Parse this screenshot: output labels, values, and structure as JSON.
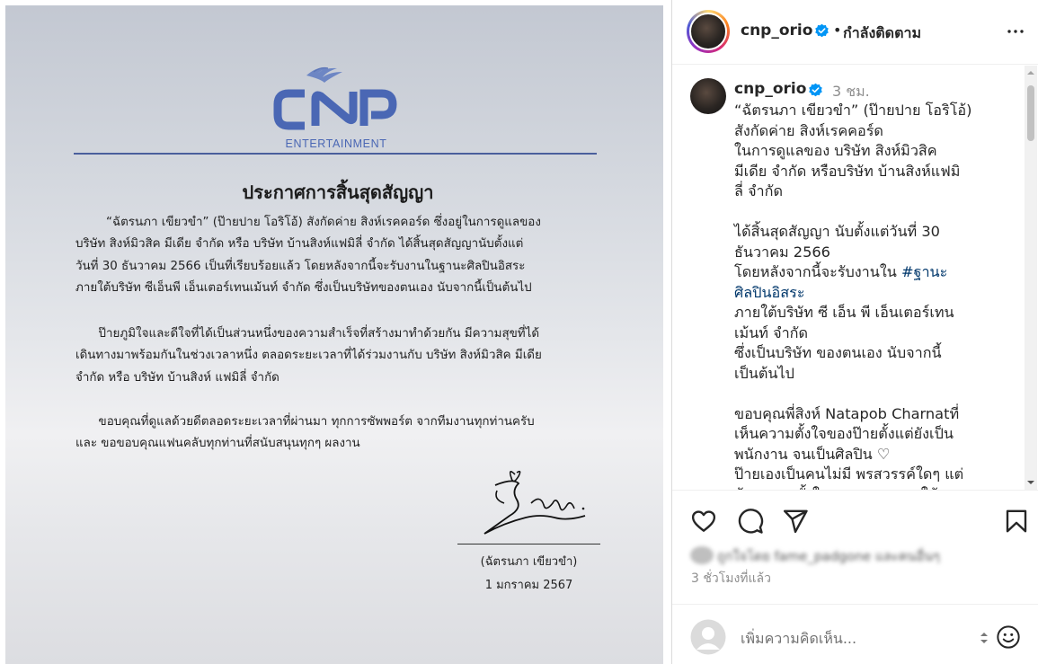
{
  "announcement": {
    "logo_text": "ENTERTAINMENT",
    "title": "ประกาศการสิ้นสุดสัญญา",
    "paragraphs": [
      [
        "        “ฉัตรนภา เขียวขำ” (ป๊ายปาย โอริโอ้) สังกัดค่าย สิงห์เรคคอร์ด ซึ่งอยู่ในการดูแลของ",
        "บริษัท สิงห์มิวสิค มีเดีย จำกัด หรือ บริษัท บ้านสิงห์แฟมิลี่ จำกัด ได้สิ้นสุดสัญญานับตั้งแต่",
        "วันที่ 30 ธันวาคม 2566 เป็นที่เรียบร้อยแล้ว โดยหลังจากนี้จะรับงานในฐานะศิลปินอิสระ",
        "ภายใต้บริษัท ซีเอ็นพี เอ็นเตอร์เทนเม้นท์ จำกัด ซึ่งเป็นบริษัทของตนเอง นับจากนี้เป็นต้นไป"
      ],
      [
        "      ป๊ายภูมิใจและดีใจที่ได้เป็นส่วนหนึ่งของความสำเร็จที่สร้างมาทำด้วยกัน มีความสุขที่ได้",
        "เดินทางมาพร้อมกันในช่วงเวลาหนึ่ง ตลอดระยะเวลาที่ได้ร่วมงานกับ บริษัท สิงห์มิวสิค มีเดีย",
        "จำกัด หรือ บริษัท บ้านสิงห์ แฟมิลี่ จำกัด"
      ],
      [
        "      ขอบคุณที่ดูแลด้วยดีตลอดระยะเวลาที่ผ่านมา ทุกการซัพพอร์ต จากทีมงานทุกท่านครับ",
        "และ ขอขอบคุณแฟนคลับทุกท่านที่สนับสนุนทุกๆ ผลงาน"
      ]
    ],
    "signature_name": "(ฉัตรนภา เขียวขำ)",
    "signature_date": "1 มกราคม 2567"
  },
  "header": {
    "username": "cnp_orio",
    "separator": "•",
    "follow_status": "กำลังติดตาม",
    "more_icon": "more-horizontal-icon"
  },
  "caption": {
    "username": "cnp_orio",
    "time": "3 ชม.",
    "lines": [
      {
        "text": "“ฉัตรนภา เขียวขำ” (ป๊ายปาย โอริโอ้)"
      },
      {
        "text": "สังกัดค่าย สิงห์เรคคอร์ด"
      },
      {
        "text": "ในการดูแลของ บริษัท สิงห์มิวสิค"
      },
      {
        "text": "มีเดีย จำกัด หรือบริษัท บ้านสิงห์แฟมิ"
      },
      {
        "text": "ลี่ จำกัด"
      },
      {
        "text": ""
      },
      {
        "text": "ได้สิ้นสุดสัญญา นับตั้งแต่วันที่ 30"
      },
      {
        "text": "ธันวาคม 2566"
      },
      {
        "text": "โดยหลังจากนี้จะรับงานใน ",
        "hashtag": "#ฐานะ"
      },
      {
        "text": "",
        "hashtag": "ศิลปินอิสระ"
      },
      {
        "text": "ภายใต้บริษัท ซี เอ็น พี เอ็นเตอร์เทน"
      },
      {
        "text": "เม้นท์ จำกัด"
      },
      {
        "text": "ซึ่งเป็นบริษัท ของตนเอง นับจากนี้"
      },
      {
        "text": "เป็นต้นไป"
      },
      {
        "text": ""
      },
      {
        "text": "ขอบคุณพี่สิงห์ Natapob Charnatที่"
      },
      {
        "text": "เห็นความตั้งใจของป๊ายตั้งแต่ยังเป็น"
      },
      {
        "text": "พนักงาน จนเป็นศิลปิน ♡"
      },
      {
        "text": "ป๊ายเองเป็นคนไม่มี พรสวรรค์ใดๆ แต่"
      },
      {
        "text": "ด้วยความตั้งใจ ความพยายามใช้ทุก"
      }
    ]
  },
  "actions": {
    "like_icon": "heart-icon",
    "comment_icon": "comment-icon",
    "share_icon": "share-icon",
    "save_icon": "bookmark-icon"
  },
  "likes": {
    "text": "ถูกใจโดย fame_padgone และคนอื่นๆ"
  },
  "post_age": "3 ชั่วโมงที่แล้ว",
  "comment": {
    "placeholder": "เพิ่มความคิดเห็น...",
    "emoji_icon": "emoji-icon"
  },
  "colors": {
    "brand_blue": "#4a5f9c",
    "verified_blue": "#0095f6",
    "hashtag": "#00376b",
    "muted_text": "#8e8e8e"
  }
}
